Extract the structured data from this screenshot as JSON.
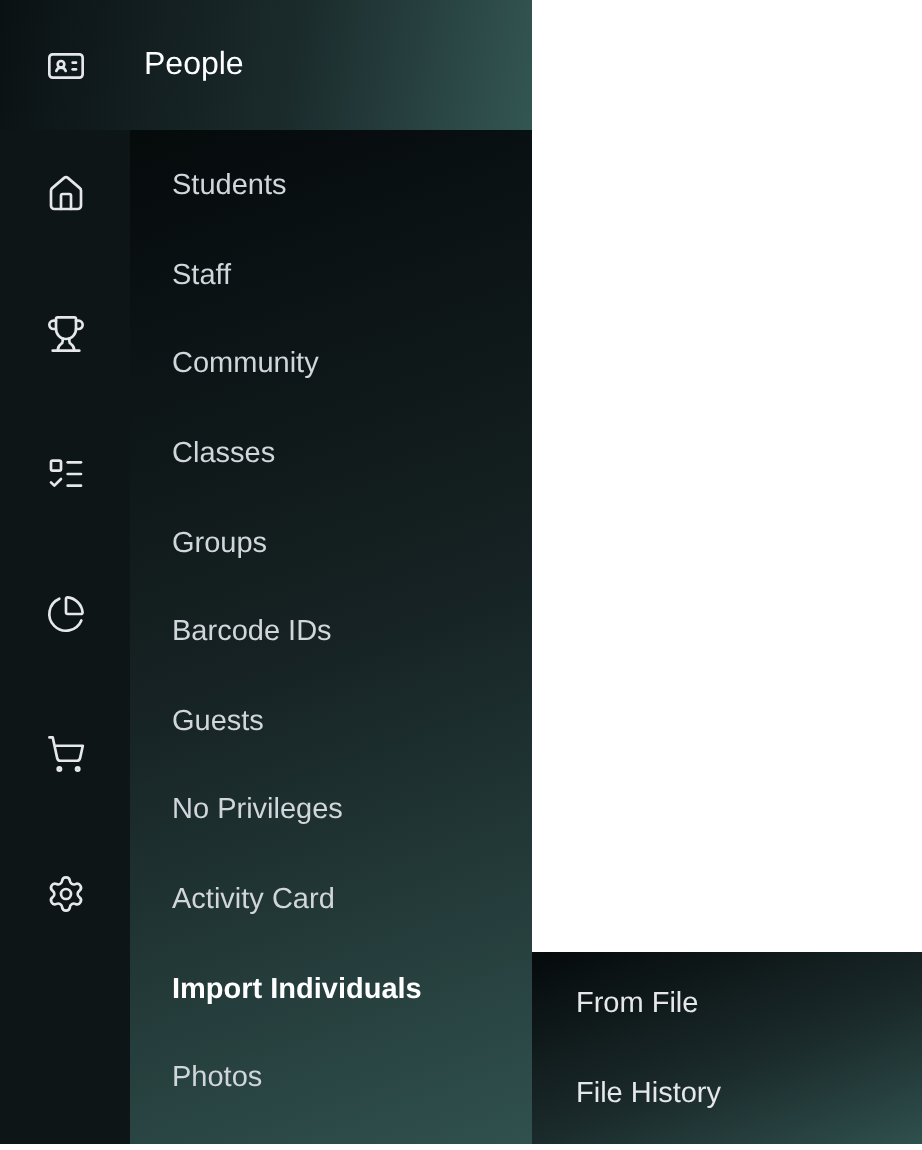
{
  "header": {
    "title": "People"
  },
  "rail": [
    {
      "kind": "home"
    },
    {
      "kind": "trophy"
    },
    {
      "kind": "list"
    },
    {
      "kind": "pie"
    },
    {
      "kind": "cart"
    },
    {
      "kind": "settings"
    }
  ],
  "menu": [
    {
      "label": "Students",
      "selected": false
    },
    {
      "label": "Staff",
      "selected": false
    },
    {
      "label": "Community",
      "selected": false
    },
    {
      "label": "Classes",
      "selected": false
    },
    {
      "label": "Groups",
      "selected": false
    },
    {
      "label": "Barcode IDs",
      "selected": false
    },
    {
      "label": "Guests",
      "selected": false
    },
    {
      "label": "No Privileges",
      "selected": false
    },
    {
      "label": "Activity Card",
      "selected": false
    },
    {
      "label": "Import Individuals",
      "selected": true
    },
    {
      "label": "Photos",
      "selected": false
    }
  ],
  "submenu": [
    {
      "label": "From File"
    },
    {
      "label": "File History"
    }
  ]
}
